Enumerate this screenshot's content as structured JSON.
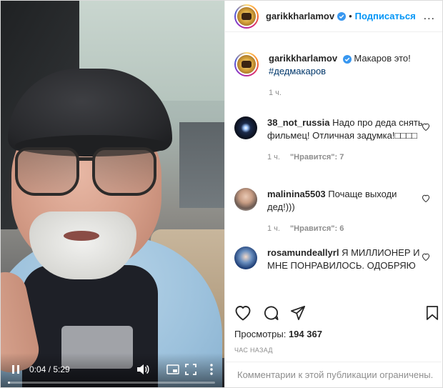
{
  "video": {
    "timecode": "0:04 / 5:29",
    "progress": 0.012
  },
  "header": {
    "username": "garikkharlamov",
    "separator": "•",
    "follow_label": "Подписаться",
    "more_label": "..."
  },
  "caption": {
    "username": "garikkharlamov",
    "text": "Макаров это!",
    "hashtag": "#дедмакаров",
    "time": "1 ч."
  },
  "comments": [
    {
      "username": "38_not_russia",
      "text": "Надо про деда снять фильмец! Отличная задумка!□□□□",
      "time": "1 ч.",
      "likes": "\"Нравится\": 7"
    },
    {
      "username": "malinina5503",
      "text": "Почаще выходи дед!)))",
      "time": "1 ч.",
      "likes": "\"Нравится\": 6"
    },
    {
      "username": "rosamundeallyrl",
      "text": "Я МИЛЛИОНЕР И МНЕ ПОНРАВИЛОСЬ. ОДОБРЯЮ"
    }
  ],
  "stats": {
    "views_label": "Просмотры:",
    "views_value": "194 367",
    "posted_ago": "ЧАС НАЗАД"
  },
  "footer": {
    "comments_limited": "Комментарии к этой публикации ограничены."
  },
  "colors": {
    "accent": "#0095f6",
    "hashtag": "#00376b",
    "muted": "#8e8e8e",
    "verified": "#3897f0"
  },
  "icons": [
    "pause-icon",
    "volume-icon",
    "pip-icon",
    "fullscreen-icon",
    "more-vertical-icon",
    "verified-icon",
    "heart-icon",
    "comment-icon",
    "share-icon",
    "bookmark-icon"
  ]
}
